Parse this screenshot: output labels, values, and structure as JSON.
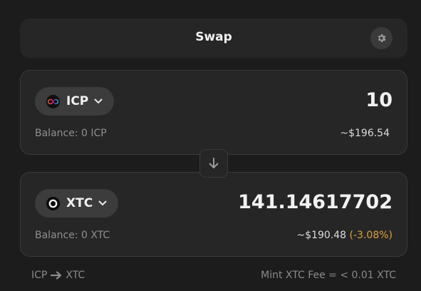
{
  "header": {
    "title": "Swap",
    "settings_icon": "gear-icon"
  },
  "from": {
    "token": "ICP",
    "token_icon": "infinity-logo-icon",
    "amount": "10",
    "balance": "Balance: 0 ICP",
    "usd_value": "~$196.54"
  },
  "switch": {
    "icon": "arrow-down-icon"
  },
  "to": {
    "token": "XTC",
    "token_icon": "ring-logo-icon",
    "amount": "141.14617702",
    "balance": "Balance: 0 XTC",
    "usd_value": "~$190.48",
    "price_impact": "(-3.08%)"
  },
  "footer": {
    "route_from": "ICP",
    "route_to": "XTC",
    "fee": "Mint XTC Fee = < 0.01 XTC"
  },
  "colors": {
    "background": "#1c1c1c",
    "card": "#262626",
    "price_impact": "#e0a23a"
  }
}
